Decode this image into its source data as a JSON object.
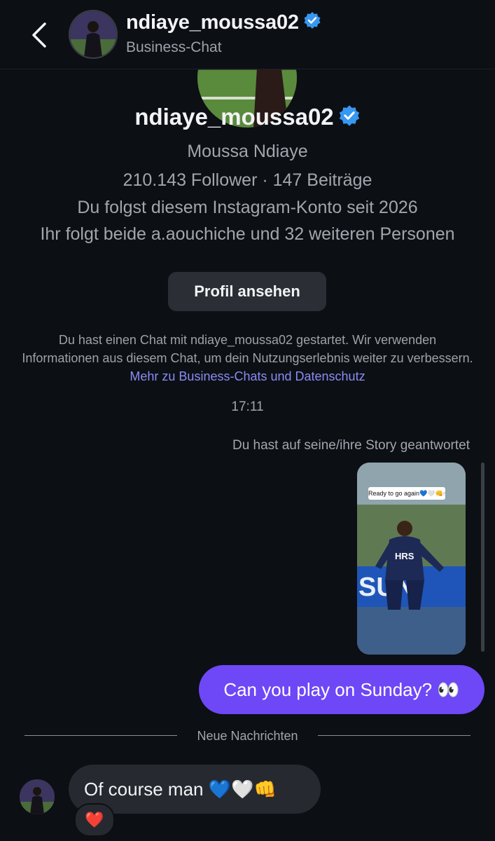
{
  "header": {
    "username": "ndiaye_moussa02",
    "subtitle": "Business-Chat"
  },
  "profile": {
    "username": "ndiaye_moussa02",
    "full_name": "Moussa Ndiaye",
    "stats": "210.143 Follower · 147 Beiträge",
    "follow_since": "Du folgst diesem Instagram-Konto seit 2026",
    "mutual": "Ihr folgt beide a.aouchiche und 32 weiteren Personen",
    "view_profile_label": "Profil ansehen"
  },
  "notice": {
    "text": "Du hast einen Chat mit ndiaye_moussa02 gestartet. Wir verwenden Informationen aus diesem Chat, um dein Nutzungserlebnis weiter zu verbessern.",
    "link": "Mehr zu Business-Chats und Datenschutz"
  },
  "chat": {
    "timestamp": "17:11",
    "story_reply_note": "Du hast auf seine/ihre Story geantwortet",
    "story_caption": "Ready to go again💙🤍👊☝",
    "story_jersey_text": "HRS",
    "outgoing_message": "Can you play on Sunday? 👀",
    "divider_label": "Neue Nachrichten",
    "incoming_message": "Of course man 💙🤍👊",
    "reaction": "❤️"
  },
  "colors": {
    "background": "#0c0f14",
    "outgoing_bubble": "#6e47f7",
    "incoming_bubble": "#26292f",
    "link": "#8b8cf3",
    "verified": "#3897f0"
  }
}
